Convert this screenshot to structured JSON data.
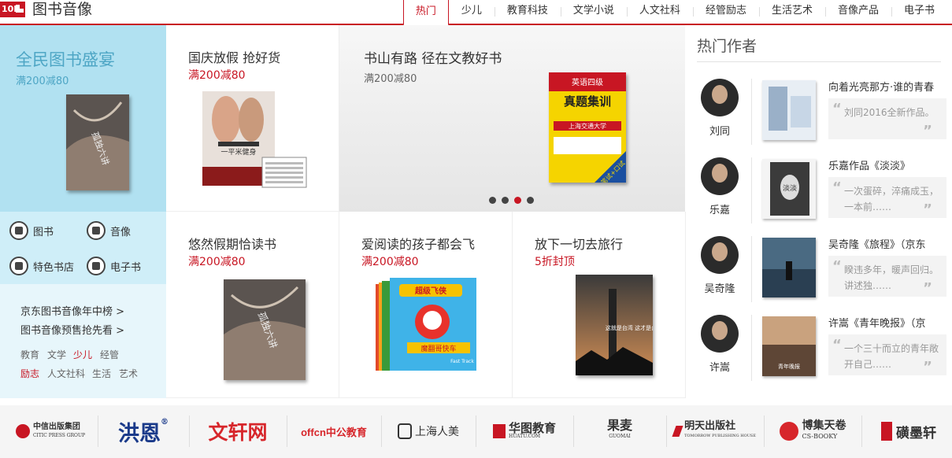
{
  "header": {
    "badge": "10F",
    "title": "图书音像",
    "tabs": [
      "热门",
      "少儿",
      "教育科技",
      "文学小说",
      "人文社科",
      "经管励志",
      "生活艺术",
      "音像产品",
      "电子书"
    ],
    "active_tab": "热门"
  },
  "promo": {
    "title": "全民图书盛宴",
    "subtitle": "满200减80"
  },
  "categories": [
    {
      "label": "图书",
      "icon": "book-icon"
    },
    {
      "label": "音像",
      "icon": "disc-icon"
    },
    {
      "label": "特色书店",
      "icon": "store-icon"
    },
    {
      "label": "电子书",
      "icon": "ebook-icon"
    }
  ],
  "links": [
    "京东图书音像年中榜 >",
    "图书音像预售抢先看 >"
  ],
  "tags": [
    {
      "label": "教育",
      "hot": false
    },
    {
      "label": "文学",
      "hot": false
    },
    {
      "label": "少儿",
      "hot": true
    },
    {
      "label": "经管",
      "hot": false
    },
    {
      "label": "励志",
      "hot": true
    },
    {
      "label": "人文社科",
      "hot": false
    },
    {
      "label": "生活",
      "hot": false
    },
    {
      "label": "艺术",
      "hot": false
    }
  ],
  "cells": {
    "national_day": {
      "title": "国庆放假 抢好货",
      "subtitle": "满200减80"
    },
    "carousel": {
      "title": "书山有路 径在文教好书",
      "subtitle": "满200减80",
      "active_dot": 3,
      "dot_count": 4
    },
    "holiday": {
      "title": "悠然假期恰读书",
      "subtitle": "满200减80"
    },
    "kids": {
      "title": "爱阅读的孩子都会飞",
      "subtitle": "满200减80"
    },
    "travel": {
      "title": "放下一切去旅行",
      "subtitle": "5折封顶"
    }
  },
  "book_text": {
    "fitness": "一平米健身",
    "exam_top": "英语四级",
    "exam_main": "真题集训",
    "exam_school": "上海交通大学",
    "exam_badge": "笔试+口试",
    "kids_title": "超级飞侠",
    "kids_sub": "魔翻哥快车",
    "kids_en": "Fast Track",
    "taiwan": "这就是台湾 这才是台湾",
    "lonely": "孤独六讲"
  },
  "authors": {
    "heading": "热门作者",
    "items": [
      {
        "name": "刘同",
        "title": "向着光亮那方·谁的青春",
        "quote": "刘同2016全新作品。"
      },
      {
        "name": "乐嘉",
        "title": "乐嘉作品《淡淡》",
        "quote": "一次蛋碎，淬痛成玉，一本前……"
      },
      {
        "name": "吴奇隆",
        "title": "吴奇隆《旅程》（京东",
        "quote": "睽违多年，暖声回归。讲述独……"
      },
      {
        "name": "许嵩",
        "title": "许嵩《青年晚报》（京",
        "quote": "一个三十而立的青年敞开自己……"
      }
    ],
    "cover_text": [
      "",
      "淡淡",
      "",
      "青年晚报"
    ]
  },
  "brands": [
    "中信出版集团",
    "洪恩",
    "文轩网",
    "offcn中公教育",
    "上海人美",
    "华图教育",
    "果麦",
    "明天出版社",
    "博集天卷",
    "磺墨轩"
  ],
  "brand_sub": {
    "citic": "CITIC PRESS GROUP",
    "huatu": "HUATU.COM",
    "guomai": "GUOMAI",
    "mingtian": "TOMORROW PUBLISHING HOUSE",
    "boji": "CS-BOOKY"
  },
  "colors": {
    "accent": "#c81623",
    "promo_bg": "#b1e1f1",
    "promo_text": "#4ea6c5"
  }
}
